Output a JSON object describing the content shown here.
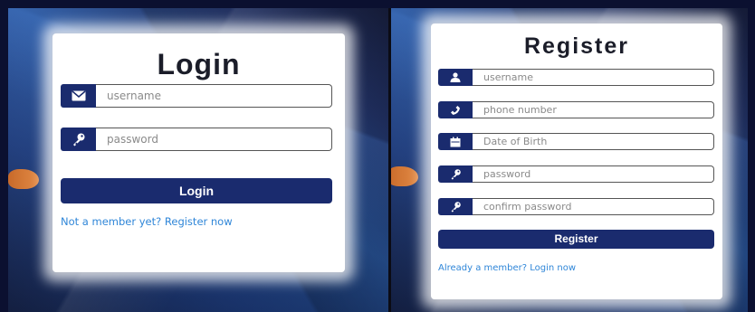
{
  "login": {
    "title": "Login",
    "username_placeholder": "username",
    "password_placeholder": "password",
    "button_label": "Login",
    "register_link": "Not a member yet? Register now"
  },
  "register": {
    "title": "Register",
    "username_placeholder": "username",
    "phone_placeholder": "phone number",
    "dob_placeholder": "Date of Birth",
    "password_placeholder": "password",
    "confirm_password_placeholder": "confirm password",
    "button_label": "Register",
    "login_link": "Already a member? Login now"
  },
  "icons": {
    "login_username": "envelope-icon",
    "login_password": "key-icon",
    "register_username": "user-icon",
    "register_phone": "phone-icon",
    "register_dob": "calendar-icon",
    "register_password": "key-icon",
    "register_confirm": "key-icon"
  },
  "colors": {
    "accent": "#1a2b6e",
    "link": "#2f86d8",
    "placeholder": "#8a8a8a"
  }
}
